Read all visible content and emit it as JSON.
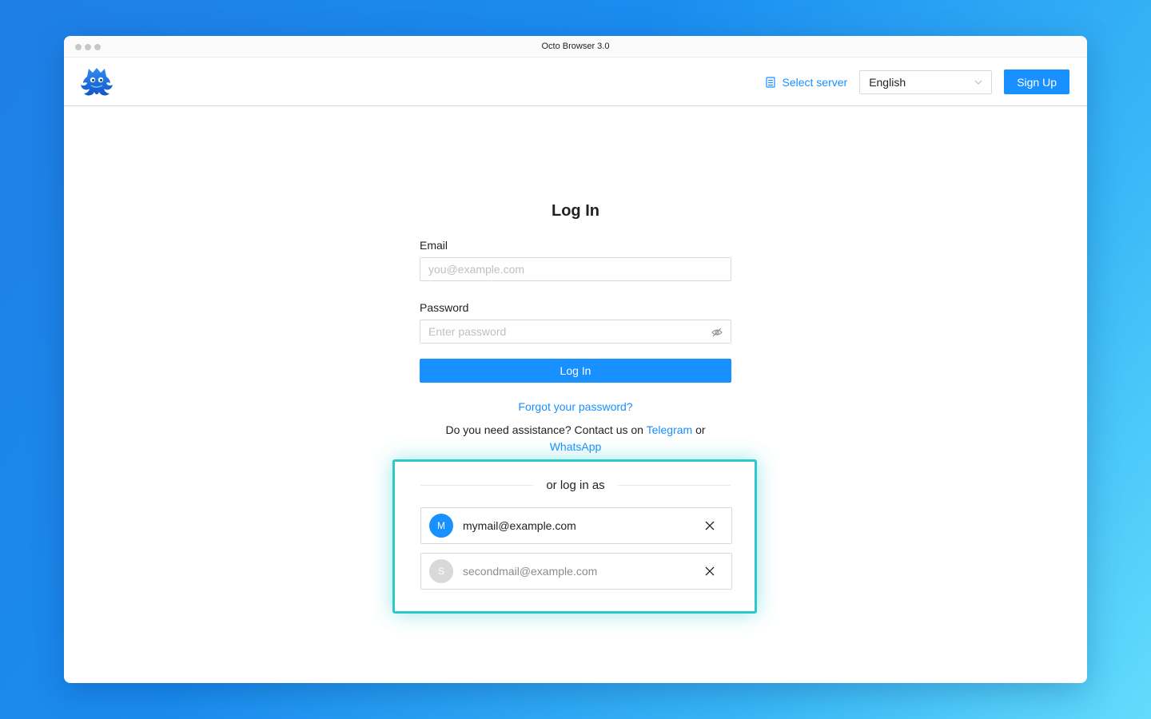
{
  "window": {
    "title": "Octo Browser 3.0"
  },
  "header": {
    "select_server_label": "Select server",
    "language_value": "English",
    "signup_label": "Sign Up"
  },
  "form": {
    "title": "Log In",
    "email_label": "Email",
    "email_placeholder": "you@example.com",
    "password_label": "Password",
    "password_placeholder": "Enter password",
    "login_label": "Log In",
    "forgot_label": "Forgot your password?",
    "assist_text": "Do you need assistance? Contact us on",
    "telegram_label": "Telegram",
    "or_text": "or",
    "whatsapp_label": "WhatsApp"
  },
  "saved_accounts": {
    "divider_text": "or log in as",
    "accounts": [
      {
        "initial": "M",
        "email": "mymail@example.com",
        "avatar_color": "#1890ff",
        "text_color": "#222222"
      },
      {
        "initial": "S",
        "email": "secondmail@example.com",
        "avatar_color": "#d9d9d9",
        "text_color": "#8c8c8c"
      }
    ]
  },
  "colors": {
    "accent": "#1890ff",
    "highlight": "#2ec8c8"
  }
}
